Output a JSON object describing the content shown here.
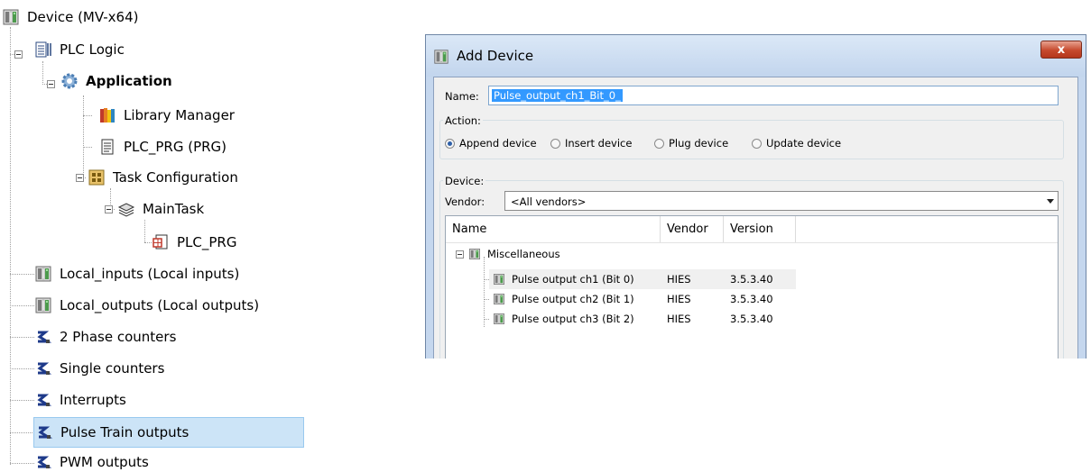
{
  "tree": {
    "items": [
      {
        "label": "Device (MV-x64)",
        "icon": "device-icon"
      },
      {
        "label": "PLC Logic",
        "icon": "plc-logic-icon"
      },
      {
        "label": "Application",
        "icon": "gear-icon"
      },
      {
        "label": "Library Manager",
        "icon": "library-books-icon"
      },
      {
        "label": "PLC_PRG (PRG)",
        "icon": "document-icon"
      },
      {
        "label": "Task Configuration",
        "icon": "task-configuration-icon"
      },
      {
        "label": "MainTask",
        "icon": "layered-task-icon"
      },
      {
        "label": "PLC_PRG",
        "icon": "program-call-icon"
      },
      {
        "label": "Local_inputs (Local inputs)",
        "icon": "device-icon"
      },
      {
        "label": "Local_outputs (Local outputs)",
        "icon": "device-icon"
      },
      {
        "label": "2 Phase counters",
        "icon": "connector-icon"
      },
      {
        "label": "Single counters",
        "icon": "connector-icon"
      },
      {
        "label": "Interrupts",
        "icon": "connector-icon"
      },
      {
        "label": "Pulse Train outputs",
        "icon": "connector-icon",
        "selected": true
      },
      {
        "label": "PWM outputs",
        "icon": "connector-icon"
      }
    ]
  },
  "dialog": {
    "title": "Add Device",
    "close_label": "x",
    "name_label": "Name:",
    "name_value": "Pulse_output_ch1_Bit_0_",
    "action": {
      "label": "Action:",
      "options": [
        {
          "label": "Append device",
          "selected": true
        },
        {
          "label": "Insert device",
          "selected": false
        },
        {
          "label": "Plug device",
          "selected": false
        },
        {
          "label": "Update device",
          "selected": false
        }
      ]
    },
    "device": {
      "label": "Device:",
      "vendor_label": "Vendor:",
      "vendor_value": "<All vendors>",
      "columns": [
        "Name",
        "Vendor",
        "Version"
      ],
      "category": "Miscellaneous",
      "rows": [
        {
          "name": "Pulse output ch1 (Bit 0)",
          "vendor": "HIES",
          "version": "3.5.3.40",
          "highlighted": true
        },
        {
          "name": "Pulse output ch2 (Bit 1)",
          "vendor": "HIES",
          "version": "3.5.3.40"
        },
        {
          "name": "Pulse output ch3 (Bit 2)",
          "vendor": "HIES",
          "version": "3.5.3.40"
        }
      ]
    }
  },
  "colors": {
    "selection": "#cce4f7",
    "title_bar": "#c5d7ee",
    "close_button": "#c6492d",
    "name_highlight": "#3399ff"
  }
}
